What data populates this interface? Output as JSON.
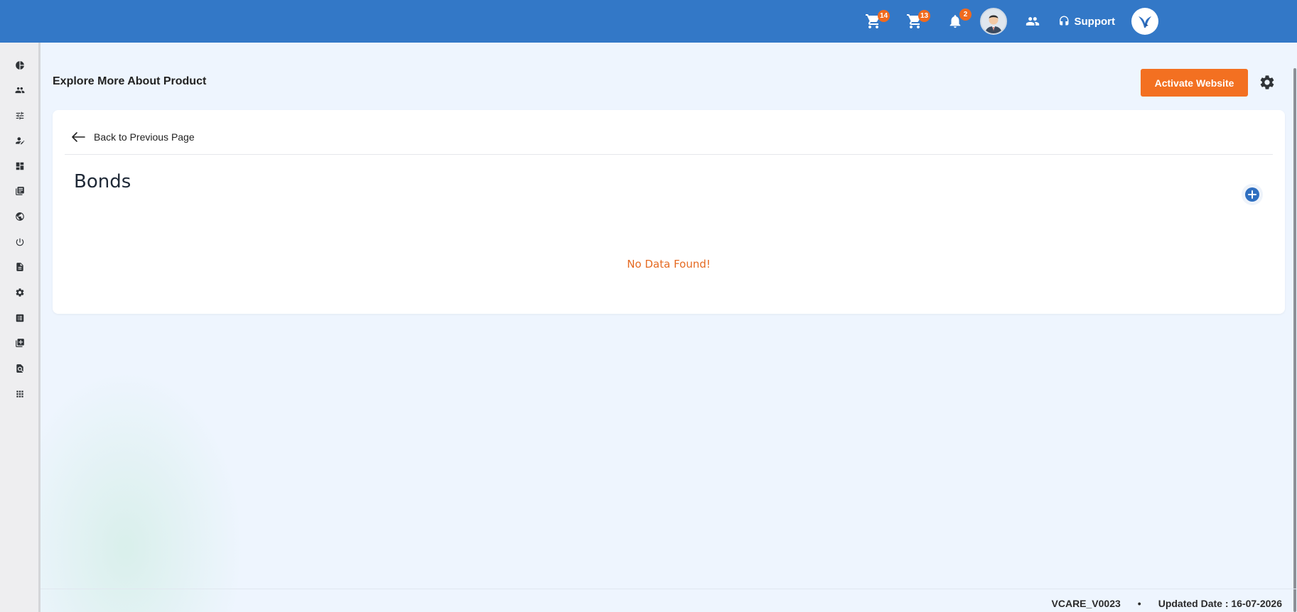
{
  "topbar": {
    "cart1_badge": "14",
    "cart2_badge": "13",
    "bell_badge": "2",
    "support_label": "Support"
  },
  "sidebar": {
    "icons": [
      "pie-chart-icon",
      "people-icon",
      "sliders-icon",
      "person-edit-icon",
      "dashboard-icon",
      "library-icon",
      "globe-icon",
      "power-icon",
      "document-icon",
      "gear-icon",
      "list-icon",
      "library-add-icon",
      "file-search-icon",
      "apps-grid-icon"
    ]
  },
  "page": {
    "title": "Explore More About Product",
    "activate_button": "Activate Website"
  },
  "card": {
    "back_label": "Back to Previous Page",
    "section_title": "Bonds",
    "empty_message": "No Data Found!"
  },
  "footer": {
    "version": "VCARE_V0023",
    "separator": "•",
    "updated": "Updated Date : 16-07-2026"
  },
  "colors": {
    "topbar": "#3378c7",
    "accent_orange": "#f37021",
    "badge": "#f06a1e",
    "background": "#eef5fe",
    "add_icon": "#2f6fc0"
  }
}
